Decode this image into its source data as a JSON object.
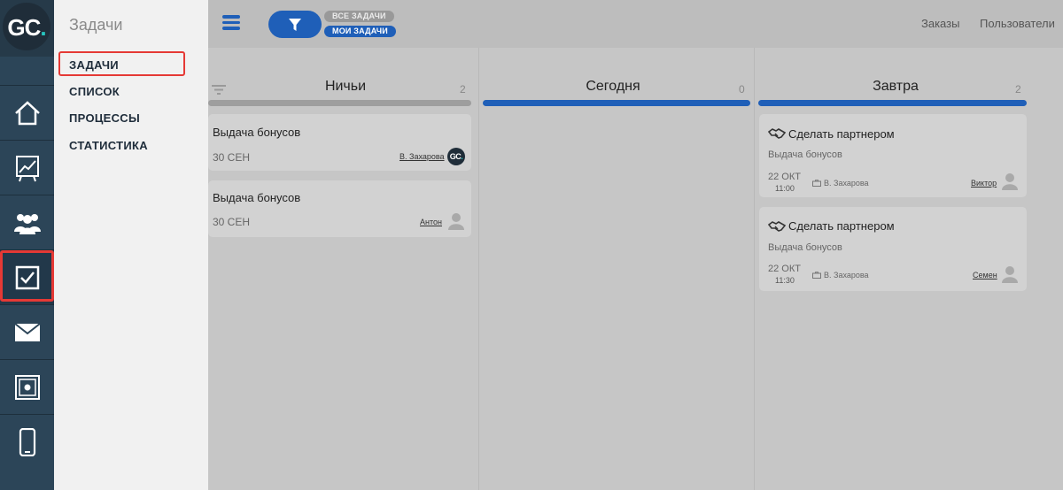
{
  "brand": {
    "logo_main": "GC",
    "logo_dot": "."
  },
  "rail": {
    "items": [
      {
        "icon": "home-icon"
      },
      {
        "icon": "chart-board-icon"
      },
      {
        "icon": "users-icon"
      },
      {
        "icon": "checkbox-icon",
        "active": true
      },
      {
        "icon": "mail-icon"
      },
      {
        "icon": "safe-icon"
      },
      {
        "icon": "phone-icon"
      }
    ]
  },
  "submenu": {
    "title": "Задачи",
    "items": [
      {
        "label": "ЗАДАЧИ",
        "active": true
      },
      {
        "label": "СПИСОК"
      },
      {
        "label": "ПРОЦЕССЫ"
      },
      {
        "label": "СТАТИСТИКА"
      }
    ]
  },
  "topbar": {
    "filter_all": "ВСЕ ЗАДАЧИ",
    "filter_mine": "МОИ ЗАДАЧИ",
    "links": [
      "Заказы",
      "Пользователи"
    ]
  },
  "colors": {
    "accent": "#1f5fb8",
    "highlight": "#e53935",
    "rail": "#2c4558"
  },
  "board": {
    "columns": [
      {
        "title": "Ничьи",
        "count": "2",
        "bar_color": "#9e9e9e",
        "cards": [
          {
            "title": "Выдача бонусов",
            "amount": "30 СЕН",
            "owner": "В. Захарова"
          },
          {
            "title": "Выдача бонусов",
            "amount": "30 СЕН",
            "owner": "Антон"
          }
        ]
      },
      {
        "title": "Сегодня",
        "count": "0",
        "bar_color": "#1f5fb8",
        "cards": []
      },
      {
        "title": "Завтра",
        "count": "2",
        "bar_color": "#1f5fb8",
        "cards": [
          {
            "title": "Сделать партнером",
            "subtitle": "Выдача бонусов",
            "date": "22 ОКТ",
            "time": "11:00",
            "client": "В. Захарова",
            "owner": "Виктор"
          },
          {
            "title": "Сделать партнером",
            "subtitle": "Выдача бонусов",
            "date": "22 ОКТ",
            "time": "11:30",
            "client": "В. Захарова",
            "owner": "Семен"
          }
        ]
      }
    ]
  }
}
